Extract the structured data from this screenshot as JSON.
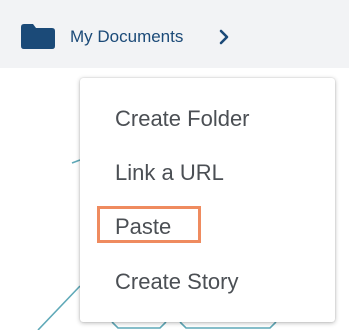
{
  "breadcrumb": {
    "folder_icon": "folder-icon",
    "label": "My Documents",
    "chevron_icon": "chevron-right-icon"
  },
  "context_menu": {
    "items": [
      {
        "label": "Create Folder"
      },
      {
        "label": "Link a URL"
      },
      {
        "label": "Paste",
        "highlighted": true
      },
      {
        "label": "Create Story"
      }
    ]
  },
  "colors": {
    "breadcrumb_text": "#1b4a78",
    "folder_icon": "#1b4a78",
    "topbar_bg": "#f2f3f5",
    "menu_text": "#4b4f54",
    "highlight_border": "#ef8b5f",
    "background_lines": "#5fa9b8"
  }
}
